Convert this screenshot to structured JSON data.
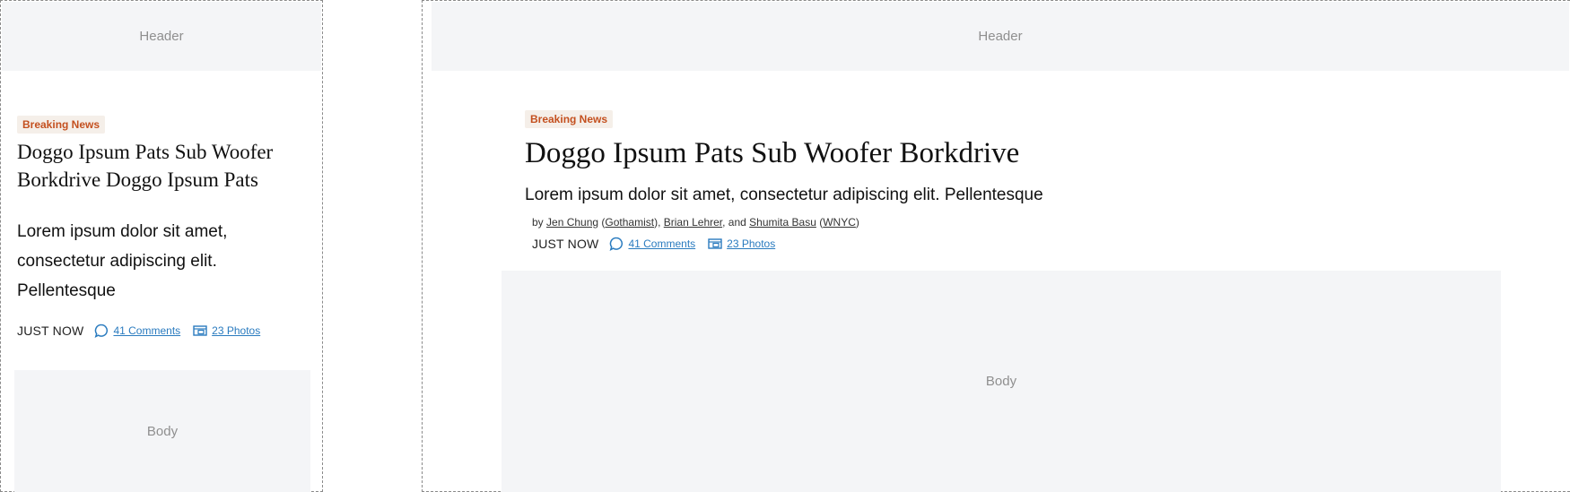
{
  "mobile": {
    "header_label": "Header",
    "tag": "Breaking News",
    "headline": "Doggo Ipsum Pats Sub Woofer Borkdrive Doggo Ipsum Pats",
    "dek": "Lorem ipsum dolor sit amet, consectetur adipiscing elit. Pellentesque",
    "timestamp": "JUST NOW",
    "comments": "41 Comments",
    "photos": "23 Photos",
    "body_label": "Body"
  },
  "desktop": {
    "header_label": "Header",
    "tag": "Breaking News",
    "headline": "Doggo Ipsum Pats Sub Woofer Borkdrive",
    "dek": "Lorem ipsum dolor sit amet, consectetur adipiscing elit. Pellentesque",
    "byline": {
      "prefix": "by ",
      "author1": "Jen Chung",
      "org1": "Gothamist",
      "author2": "Brian Lehrer",
      "and": ", and ",
      "author3": "Shumita Basu",
      "org3": "WNYC"
    },
    "timestamp": "JUST NOW",
    "comments": "41 Comments",
    "photos": "23 Photos",
    "body_label": "Body"
  },
  "colors": {
    "tag_text": "#c4501f",
    "tag_bg": "#f5efe9",
    "link": "#2a7bbf",
    "placeholder_bg": "#f4f5f7"
  },
  "icons": {
    "comments": "speech-bubble-icon",
    "photos": "photo-gallery-icon"
  }
}
